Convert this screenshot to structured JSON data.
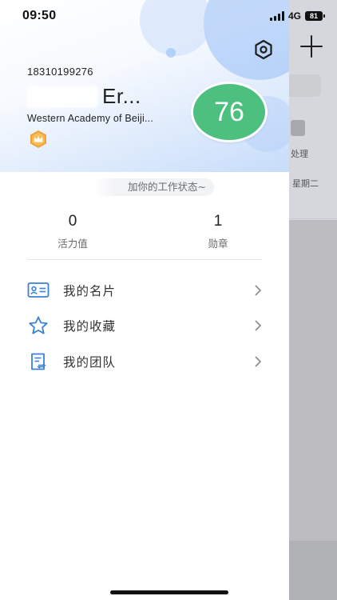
{
  "status_bar": {
    "time": "09:50",
    "network": "4G",
    "battery": "81"
  },
  "background_app": {
    "item_text": "处理",
    "date_text": "星期二"
  },
  "profile": {
    "phone": "18310199276",
    "name": "Er...",
    "organization": "Western Academy of Beiji...",
    "score": "76",
    "work_status_prompt": "加你的工作状态~"
  },
  "stats": [
    {
      "value": "0",
      "label": "活力值"
    },
    {
      "value": "1",
      "label": "勋章"
    }
  ],
  "menu": [
    {
      "label": "我的名片",
      "icon": "business-card-icon"
    },
    {
      "label": "我的收藏",
      "icon": "star-icon"
    },
    {
      "label": "我的团队",
      "icon": "team-doc-icon"
    }
  ],
  "colors": {
    "score_green": "#4dbf7e",
    "icon_blue": "#3b82d6",
    "badge_orange": "#f0a23a"
  }
}
